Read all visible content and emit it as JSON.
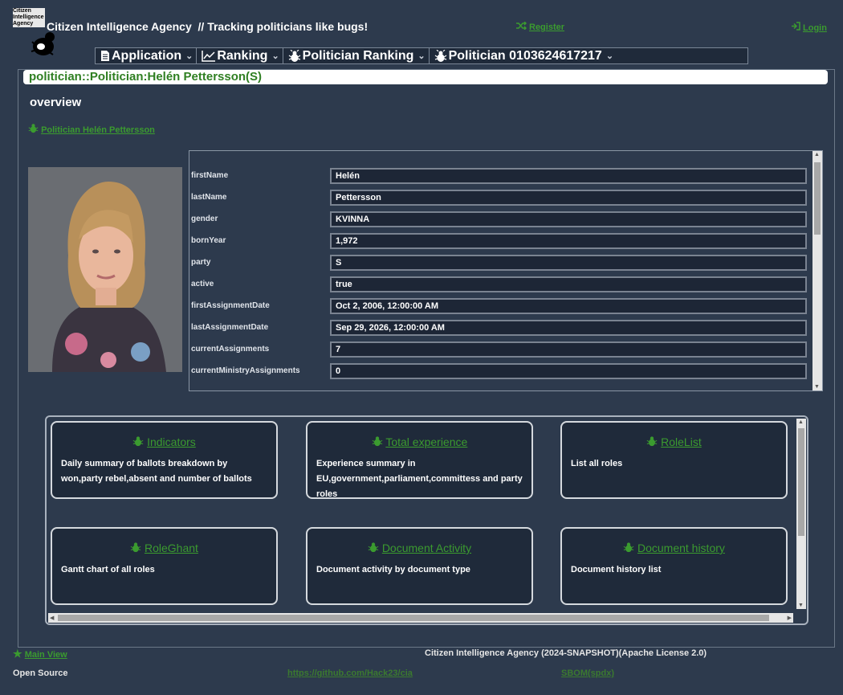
{
  "header": {
    "logo_text": "Citizen Intelligence Agency",
    "app_title": "Citizen Intelligence Agency  // Tracking politicians like bugs!",
    "register_label": "Register",
    "login_label": "Login"
  },
  "menu": {
    "items": [
      {
        "label": "Application",
        "icon": "document-icon"
      },
      {
        "label": "Ranking",
        "icon": "chart-line-icon"
      },
      {
        "label": "Politician Ranking",
        "icon": "bug-icon"
      },
      {
        "label": "Politician 0103624617217",
        "icon": "bug-icon"
      }
    ]
  },
  "page": {
    "title": "politician::Politician:Helén Pettersson(S)",
    "section_heading": "overview",
    "politician_link": "Politician Helén Pettersson"
  },
  "form": {
    "fields": [
      {
        "label": "firstName",
        "value": "Helén"
      },
      {
        "label": "lastName",
        "value": "Pettersson"
      },
      {
        "label": "gender",
        "value": "KVINNA"
      },
      {
        "label": "bornYear",
        "value": "1,972"
      },
      {
        "label": "party",
        "value": "S"
      },
      {
        "label": "active",
        "value": "true"
      },
      {
        "label": "firstAssignmentDate",
        "value": "Oct 2, 2006, 12:00:00 AM"
      },
      {
        "label": "lastAssignmentDate",
        "value": "Sep 29, 2026, 12:00:00 AM"
      },
      {
        "label": "currentAssignments",
        "value": "7"
      },
      {
        "label": "currentMinistryAssignments",
        "value": "0"
      }
    ]
  },
  "cards": [
    {
      "title": "Indicators",
      "desc": "Daily summary of ballots breakdown by won,party rebel,absent and number of ballots"
    },
    {
      "title": "Total experience",
      "desc": "Experience summary in EU,government,parliament,committess and party roles"
    },
    {
      "title": "RoleList",
      "desc": "List all roles"
    },
    {
      "title": "RoleGhant",
      "desc": "Gantt chart of all roles"
    },
    {
      "title": "Document Activity",
      "desc": "Document activity by document type"
    },
    {
      "title": "Document history",
      "desc": "Document history list"
    }
  ],
  "footer": {
    "main_view": "Main View",
    "version": "Citizen Intelligence Agency (2024-SNAPSHOT)(Apache License 2.0)",
    "open_source": "Open Source",
    "github": "https://github.com/Hack23/cia",
    "sbom": "SBOM(spdx)"
  },
  "colors": {
    "background": "#2d3a4d",
    "link": "#3b9b2f",
    "title_text": "#2f7f22"
  }
}
